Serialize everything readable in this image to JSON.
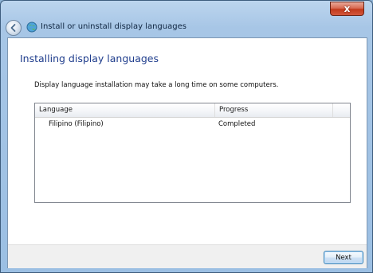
{
  "window": {
    "title": "Install or uninstall display languages",
    "close_glyph": "x"
  },
  "icons": {
    "back": "back-arrow-icon",
    "title": "globe-icon",
    "close": "close-icon"
  },
  "main": {
    "heading": "Installing display languages",
    "description": "Display language installation may take a long time on some computers."
  },
  "list": {
    "columns": [
      "Language",
      "Progress"
    ],
    "rows": [
      {
        "language": "Filipino (Filipino)",
        "progress": "Completed"
      }
    ]
  },
  "footer": {
    "next_label": "Next"
  },
  "colors": {
    "heading": "#1e3c8c",
    "titlebar": "#a7c6e6",
    "close": "#c23a1c"
  }
}
